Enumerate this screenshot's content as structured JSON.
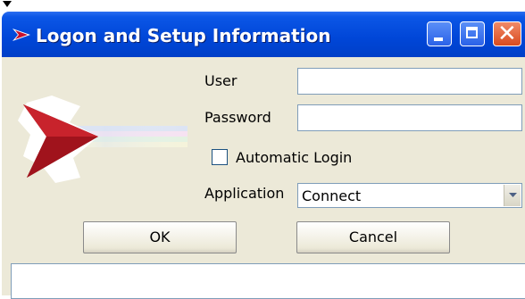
{
  "window": {
    "title": "Logon and Setup Information"
  },
  "form": {
    "user_label": "User",
    "user_value": "",
    "password_label": "Password",
    "password_value": "",
    "automatic_login_label": "Automatic Login",
    "automatic_login_checked": false,
    "application_label": "Application",
    "application_value": "Connect"
  },
  "buttons": {
    "ok": "OK",
    "cancel": "Cancel"
  },
  "icons": {
    "app": "arrow-logo-icon",
    "minimize": "minimize-icon",
    "maximize": "maximize-icon",
    "close": "close-icon",
    "dropdown": "chevron-down-icon"
  },
  "colors": {
    "titlebar": "#0046d7",
    "dialog_bg": "#ece9d8",
    "logo_red": "#b3161f",
    "close_button": "#d94b1f"
  }
}
